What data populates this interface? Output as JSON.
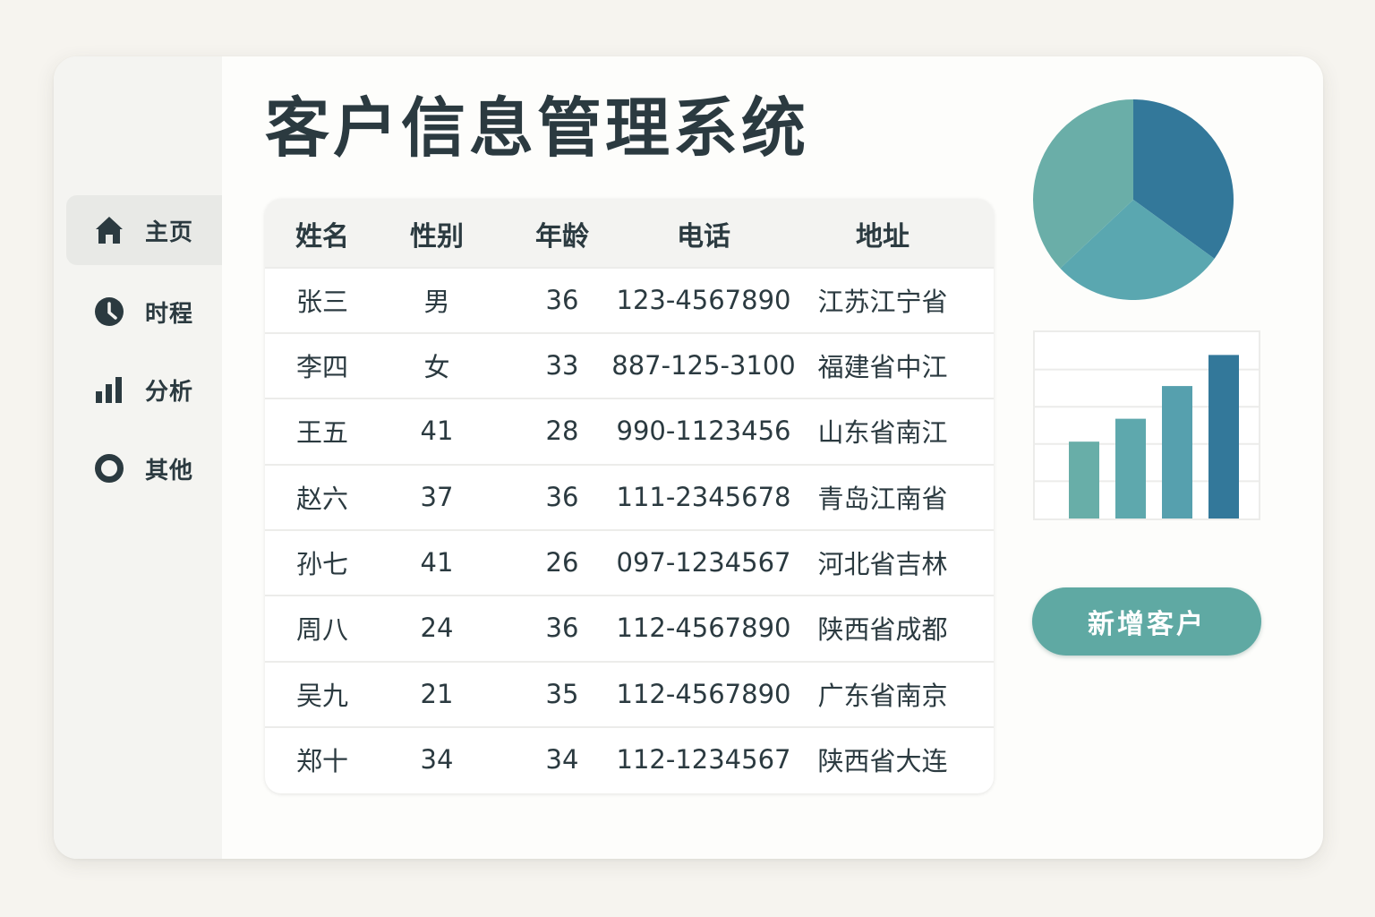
{
  "app": {
    "title": "客户信息管理系统"
  },
  "sidebar": {
    "items": [
      {
        "label": "主页",
        "icon": "home-icon",
        "active": true
      },
      {
        "label": "时程",
        "icon": "clock-icon",
        "active": false
      },
      {
        "label": "分析",
        "icon": "bar-chart-icon",
        "active": false
      },
      {
        "label": "其他",
        "icon": "circle-icon",
        "active": false
      }
    ]
  },
  "table": {
    "columns": [
      "姓名",
      "性别",
      "年龄",
      "电话",
      "地址"
    ],
    "rows": [
      [
        "张三",
        "男",
        "36",
        "123-4567890",
        "江苏江宁省"
      ],
      [
        "李四",
        "女",
        "33",
        "887-125-3100",
        "福建省中江"
      ],
      [
        "王五",
        "41",
        "28",
        "990-1123456",
        "山东省南江"
      ],
      [
        "赵六",
        "37",
        "36",
        "111-2345678",
        "青岛江南省"
      ],
      [
        "孙七",
        "41",
        "26",
        "097-1234567",
        "河北省吉林"
      ],
      [
        "周八",
        "24",
        "36",
        "112-4567890",
        "陕西省成都"
      ],
      [
        "吴九",
        "21",
        "35",
        "112-4567890",
        "广东省南京"
      ],
      [
        "郑十",
        "34",
        "34",
        "112-1234567",
        "陕西省大连"
      ]
    ]
  },
  "actions": {
    "add_customer_label": "新增客户"
  },
  "colors": {
    "primary": "#5fa9a3",
    "pie_dark": "#33789a",
    "pie_mid": "#5aa7b0",
    "pie_light": "#6aaea8",
    "bar_1": "#68aea8",
    "bar_2": "#5ea8ad",
    "bar_3": "#56a0ae",
    "bar_4": "#33789a"
  },
  "chart_data": [
    {
      "type": "pie",
      "values": [
        35,
        28,
        37
      ]
    },
    {
      "type": "bar",
      "values": [
        47,
        61,
        81,
        100
      ],
      "ylim": [
        0,
        115
      ],
      "grid": true
    }
  ]
}
